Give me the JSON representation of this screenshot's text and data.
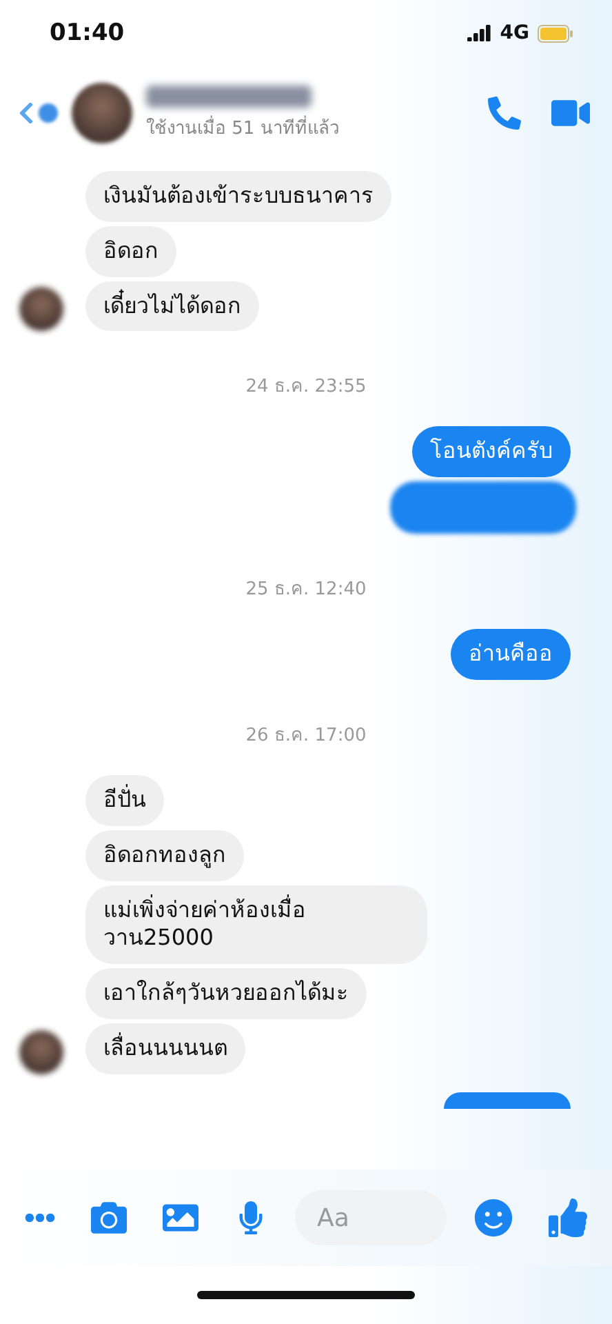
{
  "status_bar": {
    "time": "01:40",
    "network": "4G"
  },
  "header": {
    "status": "ใช้งานเมื่อ 51 นาทีที่แล้ว"
  },
  "messages": [
    {
      "kind": "text",
      "sent": false,
      "text": "เงินมันต้องเข้าระบบธนาคาร",
      "avatar": false
    },
    {
      "kind": "text",
      "sent": false,
      "text": "อิดอก",
      "avatar": false
    },
    {
      "kind": "text",
      "sent": false,
      "text": "เดี๋ยวไม่ได้ดอก",
      "avatar": true
    },
    {
      "kind": "timestamp",
      "text": "24 ธ.ค. 23:55"
    },
    {
      "kind": "text",
      "sent": true,
      "text": "โอนตังค์ครับ"
    },
    {
      "kind": "blurred",
      "sent": true
    },
    {
      "kind": "timestamp",
      "text": "25 ธ.ค. 12:40"
    },
    {
      "kind": "text",
      "sent": true,
      "text": "อ่านคืออ"
    },
    {
      "kind": "timestamp",
      "text": "26 ธ.ค. 17:00"
    },
    {
      "kind": "text",
      "sent": false,
      "text": "อีปั่น",
      "avatar": false
    },
    {
      "kind": "text",
      "sent": false,
      "text": "อิดอกทองลูก",
      "avatar": false
    },
    {
      "kind": "text",
      "sent": false,
      "text": "แม่เพิ่งจ่ายค่าห้องเมื่อวาน25000",
      "avatar": false
    },
    {
      "kind": "text",
      "sent": false,
      "text": "เอาใกล้ๆวันหวยออกได้มะ",
      "avatar": false
    },
    {
      "kind": "text",
      "sent": false,
      "text": "เลื่อนนนนนต",
      "avatar": true
    },
    {
      "kind": "cut_off",
      "sent": true
    }
  ],
  "composer": {
    "placeholder": "Aa"
  }
}
